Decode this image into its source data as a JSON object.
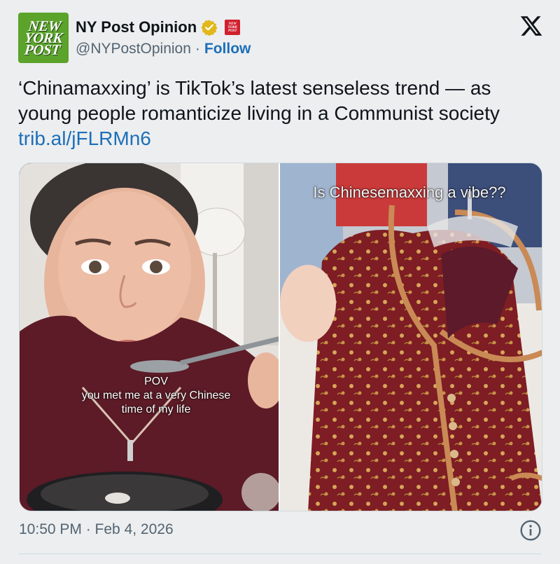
{
  "account": {
    "display_name": "NY Post Opinion",
    "handle": "@NYPostOpinion",
    "separator": "·",
    "follow_label": "Follow",
    "avatar_text": "NEW YORK POST",
    "avatar_color": "#5ba32b",
    "verified_badge": "gold-verified-badge-icon",
    "affiliate_badge": "ny-post-affiliate-badge-icon",
    "affiliate_text": "NEW YORK POST"
  },
  "platform_icon": "x-logo-icon",
  "tweet": {
    "text": "‘Chinamaxxing’ is TikTok’s latest senseless trend — as young people romanticize living in a Communist society",
    "link": "trib.al/jFLRMn6"
  },
  "media": {
    "left_caption_title": "POV",
    "left_caption_body": "you met me at a very Chinese time of my life",
    "right_caption": "Is Chinesemaxxing a vibe??"
  },
  "footer": {
    "timestamp": "10:50 PM · Feb 4, 2026",
    "info_icon": "info-icon"
  },
  "colors": {
    "link": "#1d6fb8",
    "background": "#eceef0",
    "secondary_text": "#536471"
  }
}
